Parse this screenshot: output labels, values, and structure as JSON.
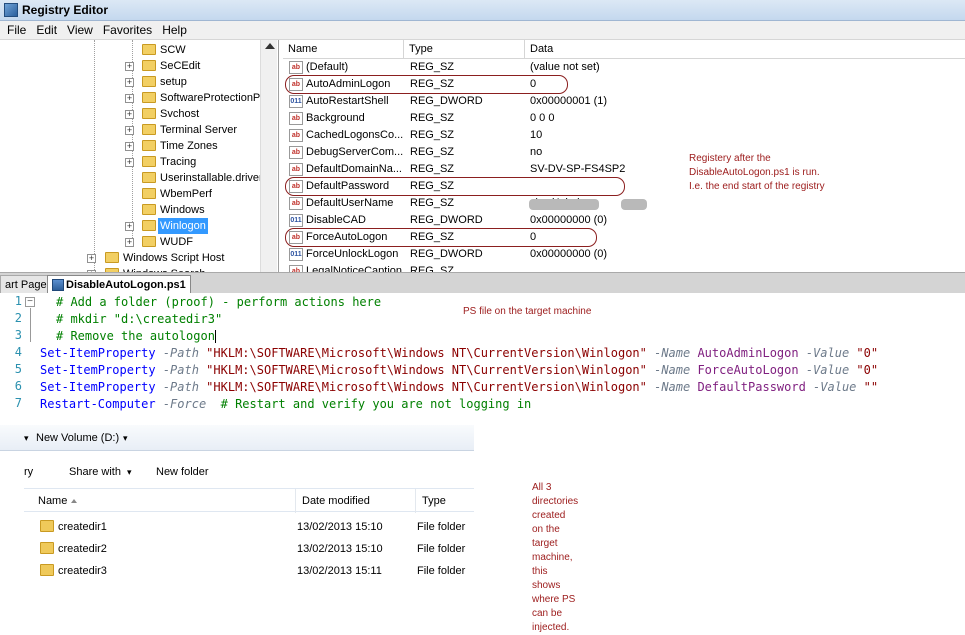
{
  "registry": {
    "title": "Registry Editor",
    "menu": [
      "File",
      "Edit",
      "View",
      "Favorites",
      "Help"
    ],
    "tree": [
      {
        "label": "SCW",
        "expander": ""
      },
      {
        "label": "SeCEdit",
        "expander": "+"
      },
      {
        "label": "setup",
        "expander": "+"
      },
      {
        "label": "SoftwareProtectionPl",
        "expander": "+"
      },
      {
        "label": "Svchost",
        "expander": "+"
      },
      {
        "label": "Terminal Server",
        "expander": "+"
      },
      {
        "label": "Time Zones",
        "expander": "+"
      },
      {
        "label": "Tracing",
        "expander": "+"
      },
      {
        "label": "Userinstallable.driver",
        "expander": ""
      },
      {
        "label": "WbemPerf",
        "expander": ""
      },
      {
        "label": "Windows",
        "expander": ""
      },
      {
        "label": "Winlogon",
        "expander": "+",
        "selected": true
      },
      {
        "label": "WUDF",
        "expander": "+"
      },
      {
        "label": "Windows Script Host",
        "expander": "+"
      },
      {
        "label": "Windows Search",
        "expander": "+"
      }
    ],
    "columns": {
      "name": "Name",
      "type": "Type",
      "data": "Data"
    },
    "values": [
      {
        "icon": "ab",
        "name": "(Default)",
        "type": "REG_SZ",
        "data": "(value not set)"
      },
      {
        "icon": "ab",
        "name": "AutoAdminLogon",
        "type": "REG_SZ",
        "data": "0",
        "highlight": true
      },
      {
        "icon": "dw",
        "name": "AutoRestartShell",
        "type": "REG_DWORD",
        "data": "0x00000001 (1)"
      },
      {
        "icon": "ab",
        "name": "Background",
        "type": "REG_SZ",
        "data": "0 0 0"
      },
      {
        "icon": "ab",
        "name": "CachedLogonsCo...",
        "type": "REG_SZ",
        "data": "10"
      },
      {
        "icon": "ab",
        "name": "DebugServerCom...",
        "type": "REG_SZ",
        "data": "no"
      },
      {
        "icon": "ab",
        "name": "DefaultDomainNa...",
        "type": "REG_SZ",
        "data": "SV-DV-SP-FS4SP2"
      },
      {
        "icon": "ab",
        "name": "DefaultPassword",
        "type": "REG_SZ",
        "data": "",
        "highlight": true
      },
      {
        "icon": "ab",
        "name": "DefaultUserName",
        "type": "REG_SZ",
        "data": "p\\ edAdmin"
      },
      {
        "icon": "dw",
        "name": "DisableCAD",
        "type": "REG_DWORD",
        "data": "0x00000000 (0)"
      },
      {
        "icon": "ab",
        "name": "ForceAutoLogon",
        "type": "REG_SZ",
        "data": "0",
        "highlight": true
      },
      {
        "icon": "dw",
        "name": "ForceUnlockLogon",
        "type": "REG_DWORD",
        "data": "0x00000000 (0)"
      },
      {
        "icon": "ab",
        "name": "LegalNoticeCaption",
        "type": "REG_SZ",
        "data": ""
      }
    ],
    "annotation": [
      "Registery after the",
      "DisableAutoLogon.ps1 is run.",
      "I.e. the end start of the registry"
    ]
  },
  "editor": {
    "tabs": {
      "start": "art Page",
      "active": "DisableAutoLogon.ps1"
    },
    "annotation": "PS file on the target machine",
    "lines": [
      {
        "n": "1",
        "segs": [
          {
            "t": "# Add a folder (proof) - perform actions here",
            "c": "c-comment"
          }
        ]
      },
      {
        "n": "2",
        "segs": [
          {
            "t": "# mkdir \"d:\\createdir3\"",
            "c": "c-comment"
          }
        ]
      },
      {
        "n": "3",
        "segs": [
          {
            "t": "# Remove the autologon",
            "c": "c-comment"
          }
        ]
      },
      {
        "n": "4",
        "segs": [
          {
            "t": "Set-ItemProperty",
            "c": "c-cmd"
          },
          {
            "t": " -Path ",
            "c": "c-param"
          },
          {
            "t": "\"HKLM:\\SOFTWARE\\Microsoft\\Windows NT\\CurrentVersion\\Winlogon\"",
            "c": "c-str"
          },
          {
            "t": " -Name ",
            "c": "c-param"
          },
          {
            "t": "AutoAdminLogon",
            "c": "c-arg"
          },
          {
            "t": " -Value ",
            "c": "c-param"
          },
          {
            "t": "\"0\"",
            "c": "c-str"
          }
        ]
      },
      {
        "n": "5",
        "segs": [
          {
            "t": "Set-ItemProperty",
            "c": "c-cmd"
          },
          {
            "t": " -Path ",
            "c": "c-param"
          },
          {
            "t": "\"HKLM:\\SOFTWARE\\Microsoft\\Windows NT\\CurrentVersion\\Winlogon\"",
            "c": "c-str"
          },
          {
            "t": " -Name ",
            "c": "c-param"
          },
          {
            "t": "ForceAutoLogon",
            "c": "c-arg"
          },
          {
            "t": " -Value ",
            "c": "c-param"
          },
          {
            "t": "\"0\"",
            "c": "c-str"
          }
        ]
      },
      {
        "n": "6",
        "segs": [
          {
            "t": "Set-ItemProperty",
            "c": "c-cmd"
          },
          {
            "t": " -Path ",
            "c": "c-param"
          },
          {
            "t": "\"HKLM:\\SOFTWARE\\Microsoft\\Windows NT\\CurrentVersion\\Winlogon\"",
            "c": "c-str"
          },
          {
            "t": " -Name ",
            "c": "c-param"
          },
          {
            "t": "DefaultPassword",
            "c": "c-arg"
          },
          {
            "t": " -Value ",
            "c": "c-param"
          },
          {
            "t": "\"\"",
            "c": "c-str"
          }
        ]
      },
      {
        "n": "7",
        "segs": [
          {
            "t": "Restart-Computer",
            "c": "c-cmd"
          },
          {
            "t": " -Force",
            "c": "c-param"
          },
          {
            "t": "  # Restart and verify you are not logging in",
            "c": "c-comment"
          }
        ]
      }
    ]
  },
  "explorer": {
    "address": "New Volume (D:)",
    "toolbar": {
      "organize": "ry",
      "share": "Share with",
      "new_folder": "New folder"
    },
    "columns": {
      "name": "Name",
      "date": "Date modified",
      "type": "Type"
    },
    "files": [
      {
        "name": "createdir1",
        "date": "13/02/2013 15:10",
        "type": "File folder"
      },
      {
        "name": "createdir2",
        "date": "13/02/2013 15:10",
        "type": "File folder"
      },
      {
        "name": "createdir3",
        "date": "13/02/2013 15:11",
        "type": "File folder"
      }
    ],
    "annotation": [
      "All 3 directories created on the",
      "target machine, this shows",
      "where PS can be injected."
    ]
  },
  "colors": {
    "annotation": "#9c1b1b",
    "selection": "#3399ff",
    "comment": "#008000",
    "command": "#0000ff",
    "string": "#8b0000"
  }
}
